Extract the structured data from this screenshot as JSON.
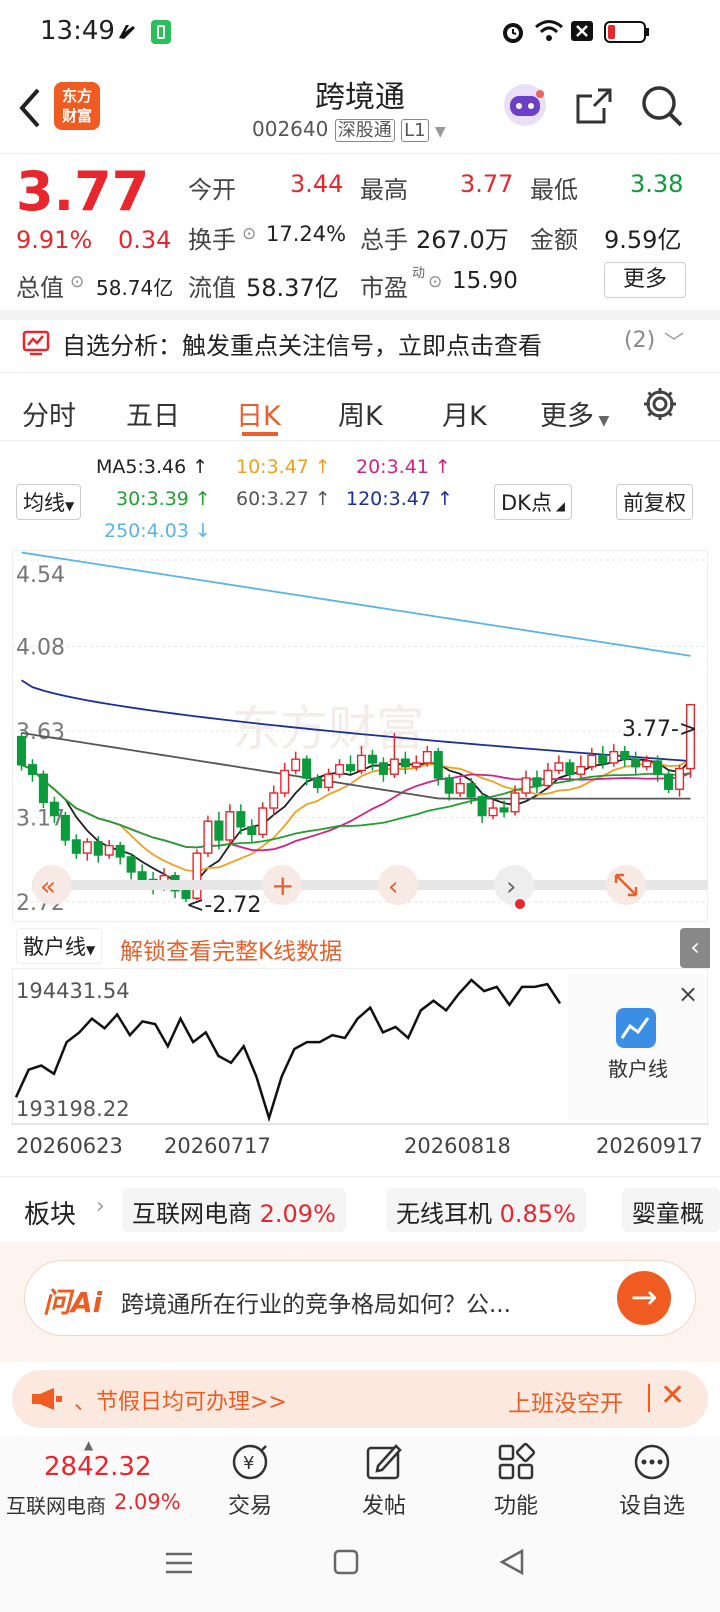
{
  "status": {
    "time": "13:49"
  },
  "header": {
    "title": "跨境通",
    "code": "002640",
    "market_tag": "深股通",
    "level_tag": "L1",
    "logo_text_1": "东方",
    "logo_text_2": "财富"
  },
  "quote": {
    "price": "3.77",
    "pct": "9.91%",
    "change": "0.34",
    "open_label": "今开",
    "open": "3.44",
    "high_label": "最高",
    "high": "3.77",
    "low_label": "最低",
    "low": "3.38",
    "turnover_label": "换手",
    "turnover": "17.24%",
    "volume_label": "总手",
    "volume": "267.0万",
    "amount_label": "金额",
    "amount": "9.59亿",
    "mktcap_label": "总值",
    "mktcap": "58.74亿",
    "float_label": "流值",
    "float": "58.37亿",
    "pe_label": "市盈",
    "pe_sup": "动",
    "pe": "15.90",
    "more": "更多"
  },
  "analysis": {
    "text": "自选分析：触发重点关注信号，立即点击查看",
    "count": "(2)"
  },
  "tabs": [
    "分时",
    "五日",
    "日K",
    "周K",
    "月K",
    "更多"
  ],
  "active_tab": "日K",
  "ma": {
    "selector": "均线",
    "ma5": "MA5:3.46",
    "ma10": "10:3.47",
    "ma20": "20:3.41",
    "ma30": "30:3.39",
    "ma60": "60:3.27",
    "ma120": "120:3.47",
    "ma250": "250:4.03",
    "dk": "DK点",
    "adjust": "前复权"
  },
  "chart": {
    "y_labels": [
      "4.54",
      "4.08",
      "3.63",
      "3.17",
      "2.72"
    ],
    "max_marker": "3.77->",
    "min_marker": "<-2.72",
    "colors": {
      "up": "#e8262d",
      "down": "#0b9a3c",
      "ma5": "#222222",
      "ma10": "#f0a020",
      "ma20": "#d0238a",
      "ma30": "#22a030",
      "ma60": "#555555",
      "ma120": "#1a2f9a",
      "ma250": "#5ab4e6"
    }
  },
  "sub": {
    "label": "散户线",
    "unlock": "解锁查看完整K线数据",
    "high": "194431.54",
    "low": "193198.22",
    "badge": "散户线",
    "dates": [
      "20260623",
      "20260717",
      "20260818",
      "20260917"
    ]
  },
  "sectors": {
    "label": "板块",
    "items": [
      {
        "name": "互联网电商",
        "pct": "2.09%"
      },
      {
        "name": "无线耳机",
        "pct": "0.85%"
      },
      {
        "name": "婴童概",
        "pct": ""
      }
    ]
  },
  "ai": {
    "logo": "问Ai",
    "question": "跨境通所在行业的竞争格局如何？公..."
  },
  "banner": {
    "left": "、节假日均可办理>>",
    "right": "上班没空开"
  },
  "bottom": {
    "index_value": "2842.32",
    "index_name": "互联网电商",
    "index_pct": "2.09%",
    "items": [
      "交易",
      "发帖",
      "功能",
      "设自选"
    ]
  },
  "chart_data": {
    "type": "candlestick",
    "ylim": [
      2.72,
      4.54
    ],
    "candles": [
      [
        3.6,
        3.45,
        3.62,
        3.42
      ],
      [
        3.45,
        3.4,
        3.48,
        3.36
      ],
      [
        3.4,
        3.25,
        3.42,
        3.22
      ],
      [
        3.25,
        3.18,
        3.28,
        3.14
      ],
      [
        3.18,
        3.05,
        3.2,
        3.02
      ],
      [
        3.05,
        2.98,
        3.08,
        2.95
      ],
      [
        2.98,
        3.04,
        3.06,
        2.94
      ],
      [
        3.04,
        2.97,
        3.07,
        2.93
      ],
      [
        2.97,
        3.02,
        3.05,
        2.95
      ],
      [
        3.02,
        2.96,
        3.04,
        2.92
      ],
      [
        2.96,
        2.88,
        2.98,
        2.84
      ],
      [
        2.88,
        2.84,
        2.92,
        2.8
      ],
      [
        2.84,
        2.8,
        2.88,
        2.76
      ],
      [
        2.8,
        2.86,
        2.9,
        2.78
      ],
      [
        2.86,
        2.78,
        2.88,
        2.74
      ],
      [
        2.78,
        2.74,
        2.82,
        2.72
      ],
      [
        2.74,
        2.98,
        3.0,
        2.73
      ],
      [
        2.98,
        3.15,
        3.18,
        2.96
      ],
      [
        3.15,
        3.05,
        3.2,
        3.0
      ],
      [
        3.05,
        3.2,
        3.24,
        3.02
      ],
      [
        3.2,
        3.12,
        3.24,
        3.08
      ],
      [
        3.12,
        3.08,
        3.16,
        3.04
      ],
      [
        3.08,
        3.22,
        3.25,
        3.06
      ],
      [
        3.22,
        3.3,
        3.34,
        3.18
      ],
      [
        3.3,
        3.42,
        3.46,
        3.28
      ],
      [
        3.42,
        3.48,
        3.52,
        3.4
      ],
      [
        3.48,
        3.38,
        3.5,
        3.34
      ],
      [
        3.38,
        3.33,
        3.4,
        3.3
      ],
      [
        3.33,
        3.4,
        3.43,
        3.31
      ],
      [
        3.4,
        3.45,
        3.48,
        3.38
      ],
      [
        3.45,
        3.42,
        3.5,
        3.4
      ],
      [
        3.42,
        3.5,
        3.55,
        3.4
      ],
      [
        3.5,
        3.46,
        3.53,
        3.42
      ],
      [
        3.46,
        3.4,
        3.49,
        3.36
      ],
      [
        3.4,
        3.48,
        3.62,
        3.38
      ],
      [
        3.48,
        3.44,
        3.52,
        3.4
      ],
      [
        3.44,
        3.46,
        3.5,
        3.42
      ],
      [
        3.46,
        3.52,
        3.55,
        3.44
      ],
      [
        3.52,
        3.38,
        3.54,
        3.34
      ],
      [
        3.38,
        3.3,
        3.4,
        3.26
      ],
      [
        3.3,
        3.35,
        3.38,
        3.28
      ],
      [
        3.35,
        3.28,
        3.38,
        3.24
      ],
      [
        3.28,
        3.18,
        3.3,
        3.14
      ],
      [
        3.18,
        3.22,
        3.26,
        3.16
      ],
      [
        3.22,
        3.2,
        3.26,
        3.17
      ],
      [
        3.2,
        3.3,
        3.34,
        3.18
      ],
      [
        3.3,
        3.38,
        3.42,
        3.28
      ],
      [
        3.38,
        3.34,
        3.42,
        3.3
      ],
      [
        3.34,
        3.42,
        3.46,
        3.32
      ],
      [
        3.42,
        3.46,
        3.5,
        3.4
      ],
      [
        3.46,
        3.4,
        3.48,
        3.36
      ],
      [
        3.4,
        3.44,
        3.5,
        3.38
      ],
      [
        3.44,
        3.5,
        3.54,
        3.42
      ],
      [
        3.5,
        3.46,
        3.55,
        3.43
      ],
      [
        3.46,
        3.52,
        3.56,
        3.44
      ],
      [
        3.52,
        3.48,
        3.55,
        3.44
      ],
      [
        3.48,
        3.44,
        3.52,
        3.4
      ],
      [
        3.44,
        3.47,
        3.5,
        3.42
      ],
      [
        3.47,
        3.4,
        3.5,
        3.36
      ],
      [
        3.4,
        3.32,
        3.42,
        3.3
      ],
      [
        3.32,
        3.43,
        3.45,
        3.28
      ],
      [
        3.43,
        3.77,
        3.77,
        3.38
      ]
    ],
    "sub_series": [
      0.15,
      0.35,
      0.38,
      0.32,
      0.55,
      0.62,
      0.72,
      0.65,
      0.75,
      0.6,
      0.7,
      0.68,
      0.52,
      0.72,
      0.55,
      0.62,
      0.45,
      0.4,
      0.52,
      0.3,
      0.0,
      0.3,
      0.5,
      0.55,
      0.55,
      0.6,
      0.58,
      0.72,
      0.8,
      0.62,
      0.66,
      0.58,
      0.78,
      0.85,
      0.78,
      0.9,
      1.0,
      0.92,
      0.95,
      0.82,
      0.95,
      0.95,
      0.97,
      0.83
    ]
  }
}
